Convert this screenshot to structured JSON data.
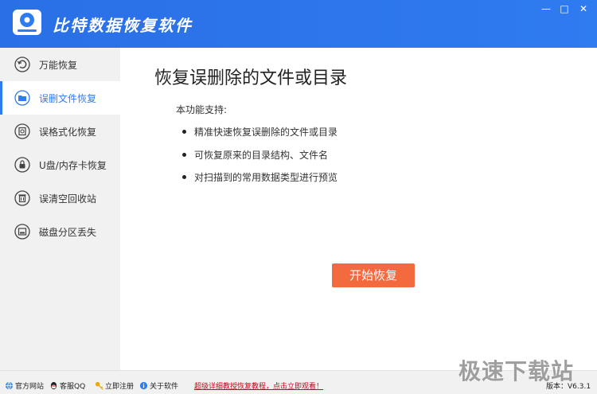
{
  "window": {
    "title": "比特数据恢复软件",
    "minimize_symbol": "—",
    "maximize_symbol": "□",
    "close_symbol": "✕"
  },
  "sidebar": {
    "items": [
      {
        "label": "万能恢复",
        "icon": "undo-icon"
      },
      {
        "label": "误删文件恢复",
        "icon": "folder-icon",
        "active": true
      },
      {
        "label": "误格式化恢复",
        "icon": "disk-format-icon"
      },
      {
        "label": "U盘/内存卡恢复",
        "icon": "usb-lock-icon"
      },
      {
        "label": "误清空回收站",
        "icon": "trash-icon"
      },
      {
        "label": "磁盘分区丢失",
        "icon": "partition-icon"
      }
    ]
  },
  "main": {
    "title": "恢复误删除的文件或目录",
    "intro": "本功能支持:",
    "features": [
      "精准快速恢复误删除的文件或目录",
      "可恢复原来的目录结构、文件名",
      "对扫描到的常用数据类型进行预览"
    ],
    "start_button": "开始恢复"
  },
  "statusbar": {
    "links": [
      {
        "label": "官方网站",
        "icon": "globe-icon"
      },
      {
        "label": "客服QQ",
        "icon": "qq-icon"
      },
      {
        "label": "立即注册",
        "icon": "key-icon"
      },
      {
        "label": "关于软件",
        "icon": "info-icon"
      }
    ],
    "promo": "超级详细教授恢复教程，点击立即观看！",
    "version_label": "版本：",
    "version_value": "V6.3.1"
  },
  "watermark": "极速下载站",
  "colors": {
    "titlebar": "#2f7bf0",
    "accent": "#2f7bf0",
    "start_button": "#f26a3d",
    "promo": "#d0021b"
  }
}
